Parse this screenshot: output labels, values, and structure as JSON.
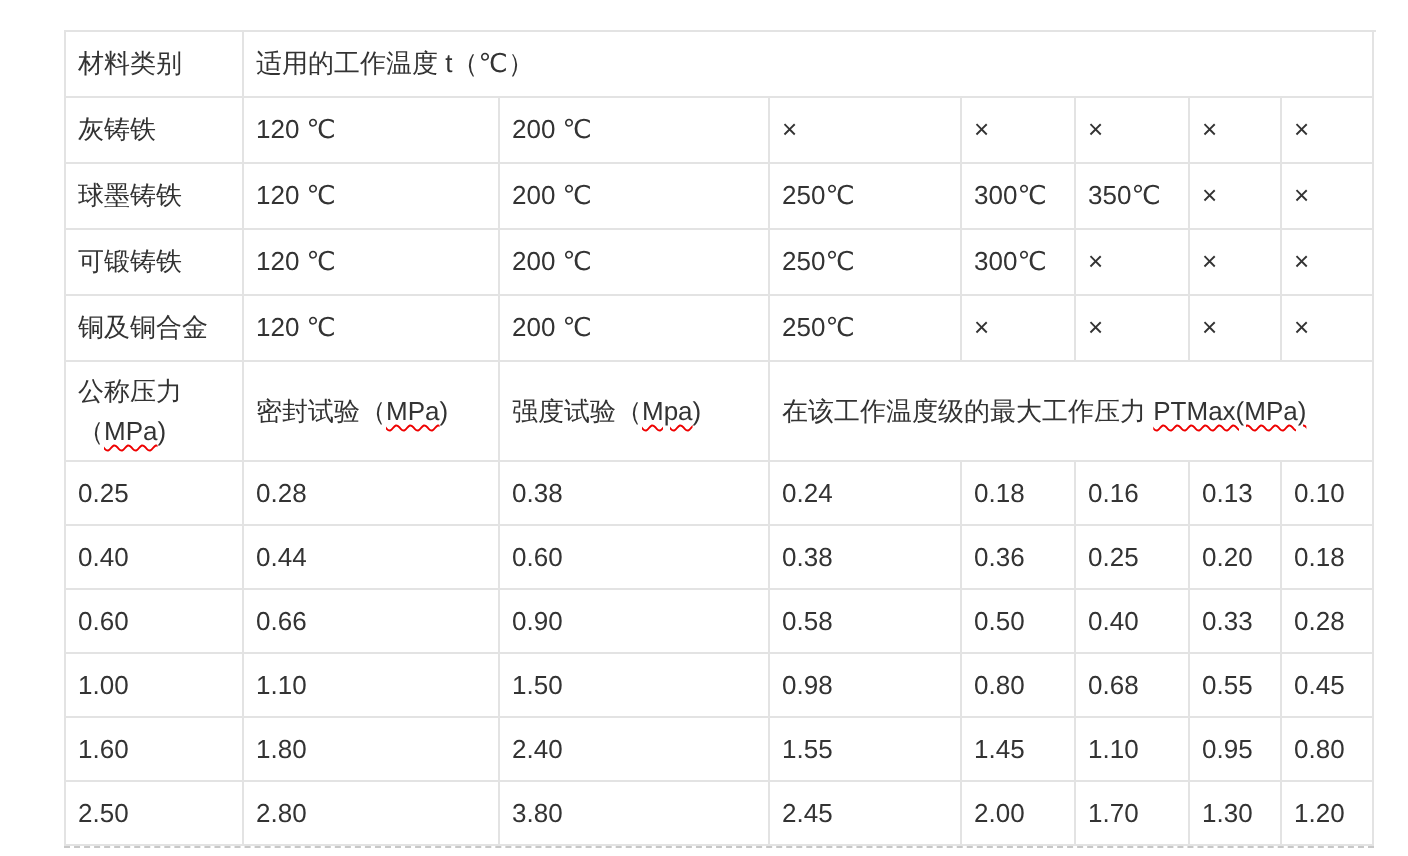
{
  "table": {
    "rows": [
      [
        {
          "text": "材料类别"
        },
        {
          "text": "适用的工作温度 t（℃）",
          "colspan": 8
        }
      ],
      [
        {
          "text": "灰铸铁"
        },
        {
          "text": "120 ℃"
        },
        {
          "text": "200 ℃"
        },
        {
          "text": "×"
        },
        {
          "text": "×"
        },
        {
          "text": "×"
        },
        {
          "text": "×"
        },
        {
          "text": "×"
        }
      ],
      [
        {
          "text": "球墨铸铁"
        },
        {
          "text": "120 ℃"
        },
        {
          "text": "200 ℃"
        },
        {
          "text": "250℃"
        },
        {
          "text": "300℃"
        },
        {
          "text": "350℃"
        },
        {
          "text": "×"
        },
        {
          "text": "×"
        }
      ],
      [
        {
          "text": "可锻铸铁"
        },
        {
          "text": "120 ℃"
        },
        {
          "text": "200 ℃"
        },
        {
          "text": "250℃"
        },
        {
          "text": "300℃"
        },
        {
          "text": "×"
        },
        {
          "text": "×"
        },
        {
          "text": "×"
        }
      ],
      [
        {
          "text": "铜及铜合金"
        },
        {
          "text": "120 ℃"
        },
        {
          "text": "200 ℃"
        },
        {
          "text": "250℃"
        },
        {
          "text": "×"
        },
        {
          "text": "×"
        },
        {
          "text": "×"
        },
        {
          "text": "×"
        }
      ],
      [
        {
          "parts": [
            {
              "text": "公称压力（",
              "misspelled": false
            },
            {
              "text": "MPa",
              "misspelled": true
            },
            {
              "text": ")",
              "misspelled": false
            }
          ]
        },
        {
          "parts": [
            {
              "text": "密封试验（",
              "misspelled": false
            },
            {
              "text": "MPa",
              "misspelled": true
            },
            {
              "text": ")",
              "misspelled": false
            }
          ]
        },
        {
          "parts": [
            {
              "text": "强度试验（",
              "misspelled": false
            },
            {
              "text": "Mpa",
              "misspelled": true
            },
            {
              "text": ")",
              "misspelled": false
            }
          ]
        },
        {
          "parts": [
            {
              "text": "在该工作温度级的最大工作压力 ",
              "misspelled": false
            },
            {
              "text": "PTMax(MPa)",
              "misspelled": true
            }
          ],
          "colspan": 5
        }
      ],
      [
        {
          "text": "0.25"
        },
        {
          "text": "0.28"
        },
        {
          "text": "0.38"
        },
        {
          "text": "0.24"
        },
        {
          "text": "0.18"
        },
        {
          "text": "0.16"
        },
        {
          "text": "0.13"
        },
        {
          "text": "0.10"
        }
      ],
      [
        {
          "text": "0.40"
        },
        {
          "text": "0.44"
        },
        {
          "text": "0.60"
        },
        {
          "text": "0.38"
        },
        {
          "text": "0.36"
        },
        {
          "text": "0.25"
        },
        {
          "text": "0.20"
        },
        {
          "text": "0.18"
        }
      ],
      [
        {
          "text": "0.60"
        },
        {
          "text": "0.66"
        },
        {
          "text": "0.90"
        },
        {
          "text": "0.58"
        },
        {
          "text": "0.50"
        },
        {
          "text": "0.40"
        },
        {
          "text": "0.33"
        },
        {
          "text": "0.28"
        }
      ],
      [
        {
          "text": "1.00"
        },
        {
          "text": "1.10"
        },
        {
          "text": "1.50"
        },
        {
          "text": "0.98"
        },
        {
          "text": "0.80"
        },
        {
          "text": "0.68"
        },
        {
          "text": "0.55"
        },
        {
          "text": "0.45"
        }
      ],
      [
        {
          "text": "1.60"
        },
        {
          "text": "1.80"
        },
        {
          "text": "2.40"
        },
        {
          "text": "1.55"
        },
        {
          "text": "1.45"
        },
        {
          "text": "1.10"
        },
        {
          "text": "0.95"
        },
        {
          "text": "0.80"
        }
      ],
      [
        {
          "text": "2.50"
        },
        {
          "text": "2.80"
        },
        {
          "text": "3.80"
        },
        {
          "text": "2.45"
        },
        {
          "text": "2.00"
        },
        {
          "text": "1.70"
        },
        {
          "text": "1.30"
        },
        {
          "text": "1.20"
        }
      ]
    ]
  }
}
